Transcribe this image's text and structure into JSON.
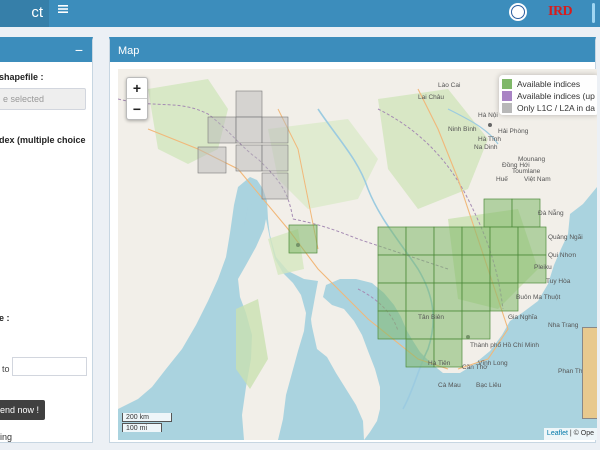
{
  "header": {
    "app_title_fragment": "ct",
    "menu_icon": "hamburger-icon",
    "partner_logo_2_text": "IRD"
  },
  "left_panel": {
    "collapse_symbol": "−",
    "shapefile_label": "shapefile :",
    "shapefile_placeholder": "e selected",
    "index_label": "dex (multiple choice",
    "date_label": "e :",
    "date_to_label": "to",
    "send_button": "Send now !",
    "bottom_text": "ing"
  },
  "map_panel": {
    "title": "Map",
    "zoom_in": "+",
    "zoom_out": "−",
    "legend": [
      {
        "label": "Available indices",
        "color": "#7fb869"
      },
      {
        "label": "Available indices (up",
        "color": "#a883c4"
      },
      {
        "label": "Only L1C / L2A in da",
        "color": "#b8b8b8"
      }
    ],
    "scale_km": "200 km",
    "scale_mi": "100 mi",
    "attribution_link": "Leaflet",
    "attribution_text": " | © Ope",
    "places": [
      "Hà Nội",
      "Hải Phòng",
      "Đồng Hới",
      "Huế",
      "Việt Nam",
      "Quảng Ngãi",
      "Pleiku",
      "Buôn Ma Thuột",
      "Nha Trang",
      "Thành phố Hồ Chí Minh",
      "Cần Thơ",
      "Vĩnh Long",
      "Bạc Liêu",
      "Mounang",
      "Toumlane",
      "Lào Cai",
      "Lai Châu",
      "Na Dinh",
      "Hà Tĩnh",
      "Ninh Bình",
      "Đà Nẵng",
      "Qui Nhơn",
      "Tuy Hòa",
      "Gia Nghĩa",
      "Cà Mau",
      "Phan Thiết",
      "Tân Biên",
      "Hà Tiên"
    ]
  }
}
